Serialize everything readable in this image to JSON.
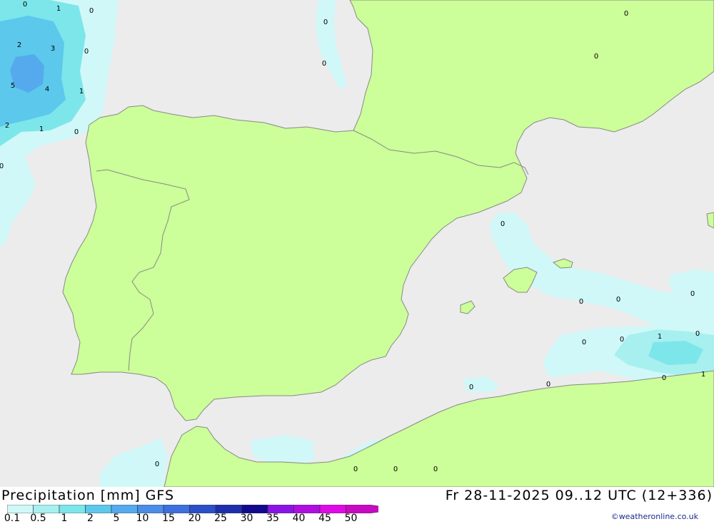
{
  "map": {
    "colors": {
      "sea": "#ececec",
      "land": "#ccff99",
      "coast": "#888888",
      "precip_0_1": "#d0f8f8",
      "precip_0_5": "#a8f0f0",
      "precip_1": "#7de6ea",
      "precip_2": "#5cc8ec",
      "precip_5": "#55aaee"
    },
    "value_labels": [
      "0",
      "1",
      "0",
      "2",
      "3",
      "0",
      "5",
      "4",
      "1",
      "2",
      "1",
      "0",
      "0",
      "0",
      "0",
      "0",
      "0",
      "0",
      "0",
      "0",
      "0",
      "0",
      "1",
      "0",
      "0",
      "1",
      "0",
      "0",
      "0",
      "0",
      "0",
      "0"
    ]
  },
  "footer": {
    "title": "Precipitation [mm] GFS",
    "valid_time": "Fr 28-11-2025 09..12 UTC (12+336)",
    "credit": "©weatheronline.co.uk",
    "legend": {
      "labels": [
        "0.1",
        "0.5",
        "1",
        "2",
        "5",
        "10",
        "15",
        "20",
        "25",
        "30",
        "35",
        "40",
        "45",
        "50"
      ],
      "colors": [
        "#d0f8f8",
        "#a8f0f0",
        "#7de6ea",
        "#5cc8ec",
        "#55aaee",
        "#4c8ee6",
        "#3d6fde",
        "#2a4fc8",
        "#1d2faa",
        "#120a8c",
        "#8a14e6",
        "#b00ee0",
        "#e00ae8",
        "#c80ac0"
      ]
    }
  }
}
